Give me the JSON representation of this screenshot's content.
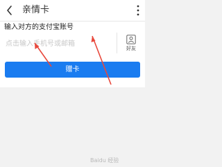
{
  "navbar": {
    "title": "亲情卡"
  },
  "form": {
    "heading": "输入对方的支付宝账号",
    "placeholder": "点击输入手机号或邮箱",
    "friend_label": "好友"
  },
  "actions": {
    "gift_label": "赠卡"
  },
  "colors": {
    "primary_button": "#1a7cf0",
    "annotation_arrow": "#e8483c"
  },
  "icons": [
    "back-arrow-icon",
    "more-icon",
    "friend-contact-icon"
  ],
  "watermark": "Baidu 经验"
}
